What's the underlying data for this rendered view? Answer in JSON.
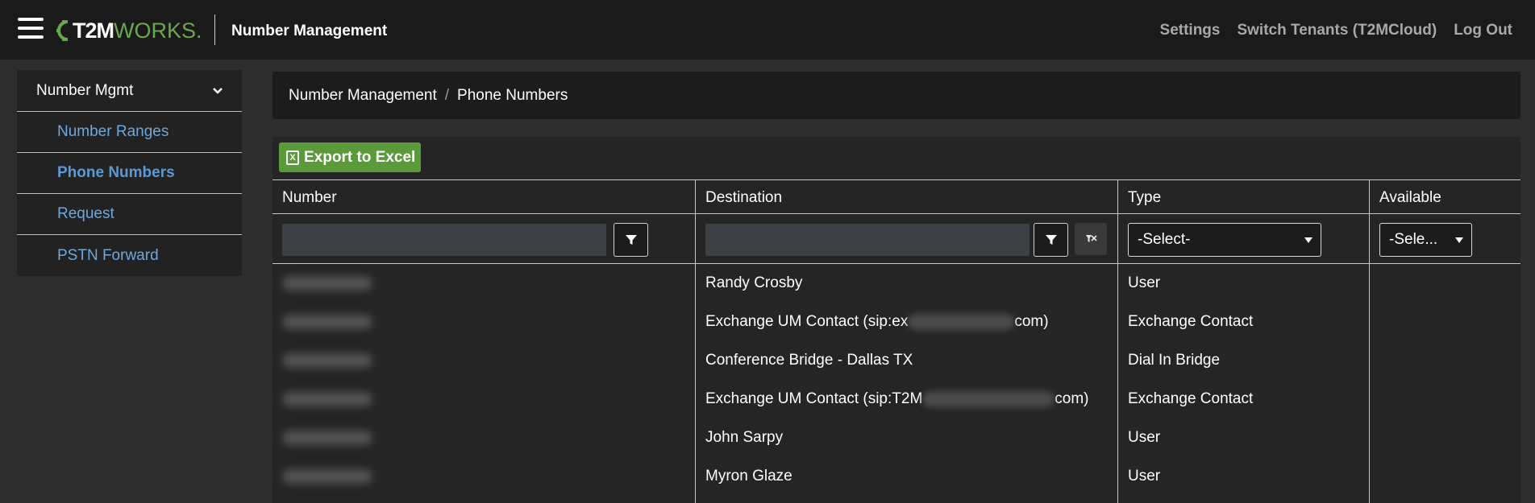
{
  "app": {
    "logo_t2m": "T2M",
    "logo_works": "WORKS.",
    "title": "Number Management"
  },
  "topnav": {
    "settings": "Settings",
    "switch_tenants": "Switch Tenants (T2MCloud)",
    "logout": "Log Out"
  },
  "sidebar": {
    "header": "Number Mgmt",
    "items": [
      {
        "label": "Number Ranges"
      },
      {
        "label": "Phone Numbers",
        "active": true
      },
      {
        "label": "Request"
      },
      {
        "label": "PSTN Forward"
      }
    ]
  },
  "breadcrumb": {
    "parent": "Number Management",
    "separator": "/",
    "current": "Phone Numbers"
  },
  "toolbar": {
    "export_label": "Export to Excel"
  },
  "grid": {
    "columns": {
      "number": "Number",
      "destination": "Destination",
      "type": "Type",
      "available": "Available"
    },
    "filters": {
      "type_select": "-Select-",
      "available_select": "-Sele..."
    },
    "rows": [
      {
        "destination": "Randy Crosby",
        "type": "User"
      },
      {
        "destination_prefix": "Exchange UM Contact (sip:ex",
        "destination_suffix": "com)",
        "type": "Exchange Contact"
      },
      {
        "destination": "Conference Bridge - Dallas TX",
        "type": "Dial In Bridge"
      },
      {
        "destination_prefix": "Exchange UM Contact (sip:T2M",
        "destination_suffix": "com)",
        "type": "Exchange Contact"
      },
      {
        "destination": "John Sarpy",
        "type": "User"
      },
      {
        "destination": "Myron Glaze",
        "type": "User"
      }
    ]
  },
  "colors": {
    "topbar": "#1a1a1a",
    "background": "#2d2d2d",
    "accent_green": "#5a9a3a",
    "link_blue": "#6fa8dc"
  }
}
